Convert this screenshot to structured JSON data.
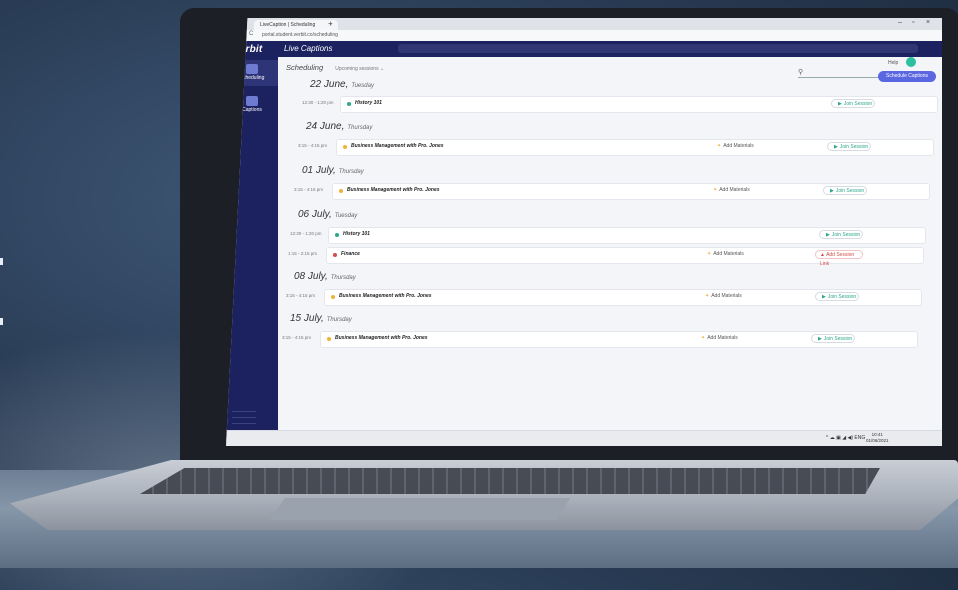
{
  "browser": {
    "tab_title": "LiveCaption | Scheduling",
    "tab_close": "×",
    "new_tab": "+",
    "url": "portal.student.verbit.co/scheduling",
    "nav_back": "←",
    "nav_forward": "→",
    "nav_reload": "C",
    "window_min": "–",
    "window_max": "▫",
    "window_close": "×"
  },
  "app": {
    "logo": "verbit",
    "title": "Live Captions",
    "sidebar": [
      {
        "label": "Scheduling",
        "active": true
      },
      {
        "label": "Captions",
        "active": false
      }
    ]
  },
  "header": {
    "page_title": "Scheduling",
    "filter_label": "Upcoming sessions",
    "help": "Help",
    "search_placeholder": "",
    "schedule_button": "Schedule Captions",
    "accent": "#5a67e0"
  },
  "sessions": [
    {
      "date": "22 June,",
      "weekday": "Tuesday",
      "time": "12:30 - 1:20 pm",
      "course": "History 101",
      "dot": "#2aa889",
      "add": "",
      "action": "Join Session",
      "lost": false
    },
    {
      "date": "24 June,",
      "weekday": "Thursday",
      "time": "3:15 - 4:15 pm",
      "course": "Business Management with Pro. Jones",
      "dot": "#f2b13a",
      "add": "Add Materials",
      "action": "Join Session",
      "lost": false
    },
    {
      "date": "01 July,",
      "weekday": "Thursday",
      "time": "3:15 - 4:15 pm",
      "course": "Business Management with Pro. Jones",
      "dot": "#f2b13a",
      "add": "Add Materials",
      "action": "Join Session",
      "lost": false
    },
    {
      "date": "06 July,",
      "weekday": "Tuesday",
      "time": "12:30 - 1:20 pm",
      "course": "History 101",
      "dot": "#2aa889",
      "add": "",
      "action": "Join Session",
      "lost": false
    },
    {
      "date": "",
      "weekday": "",
      "time": "1:15 - 2:15 pm",
      "course": "Finance",
      "dot": "#d34b4b",
      "add": "Add Materials",
      "action": "Add Session Link",
      "lost": true
    },
    {
      "date": "08 July,",
      "weekday": "Thursday",
      "time": "3:15 - 4:15 pm",
      "course": "Business Management with Pro. Jones",
      "dot": "#f2b13a",
      "add": "Add Materials",
      "action": "Join Session",
      "lost": false
    },
    {
      "date": "15 July,",
      "weekday": "Thursday",
      "time": "3:15 - 4:15 pm",
      "course": "Business Management with Pro. Jones",
      "dot": "#f2b13a",
      "add": "Add Materials",
      "action": "Join Session",
      "lost": false
    }
  ],
  "taskbar": {
    "tray": "^ ☁ ▣ ◢ ◀) ENG",
    "time": "10:41",
    "date": "01/06/2021"
  }
}
